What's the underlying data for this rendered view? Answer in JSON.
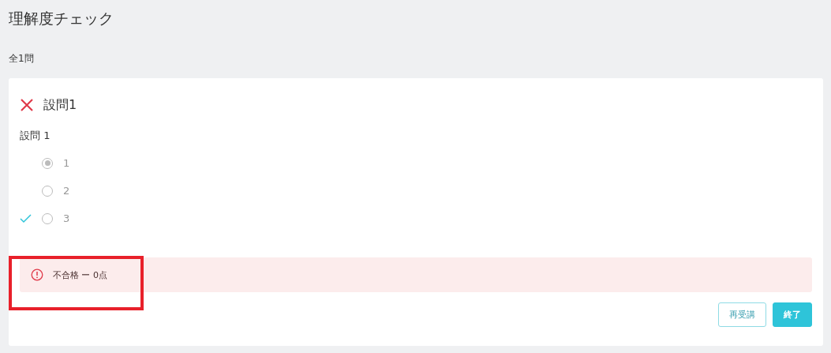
{
  "page_title": "理解度チェック",
  "question_count": "全1問",
  "questions": [
    {
      "title": "設問1",
      "correct": false,
      "prompt": "設問 1",
      "options": [
        {
          "label": "1",
          "selected": true,
          "correct": false
        },
        {
          "label": "2",
          "selected": false,
          "correct": false
        },
        {
          "label": "3",
          "selected": false,
          "correct": true
        }
      ]
    }
  ],
  "result": {
    "kind": "error",
    "text": "不合格 ー 0点",
    "highlighted": true
  },
  "buttons": [
    {
      "label": "再受講",
      "kind": "secondary"
    },
    {
      "label": "終了",
      "kind": "primary"
    }
  ]
}
